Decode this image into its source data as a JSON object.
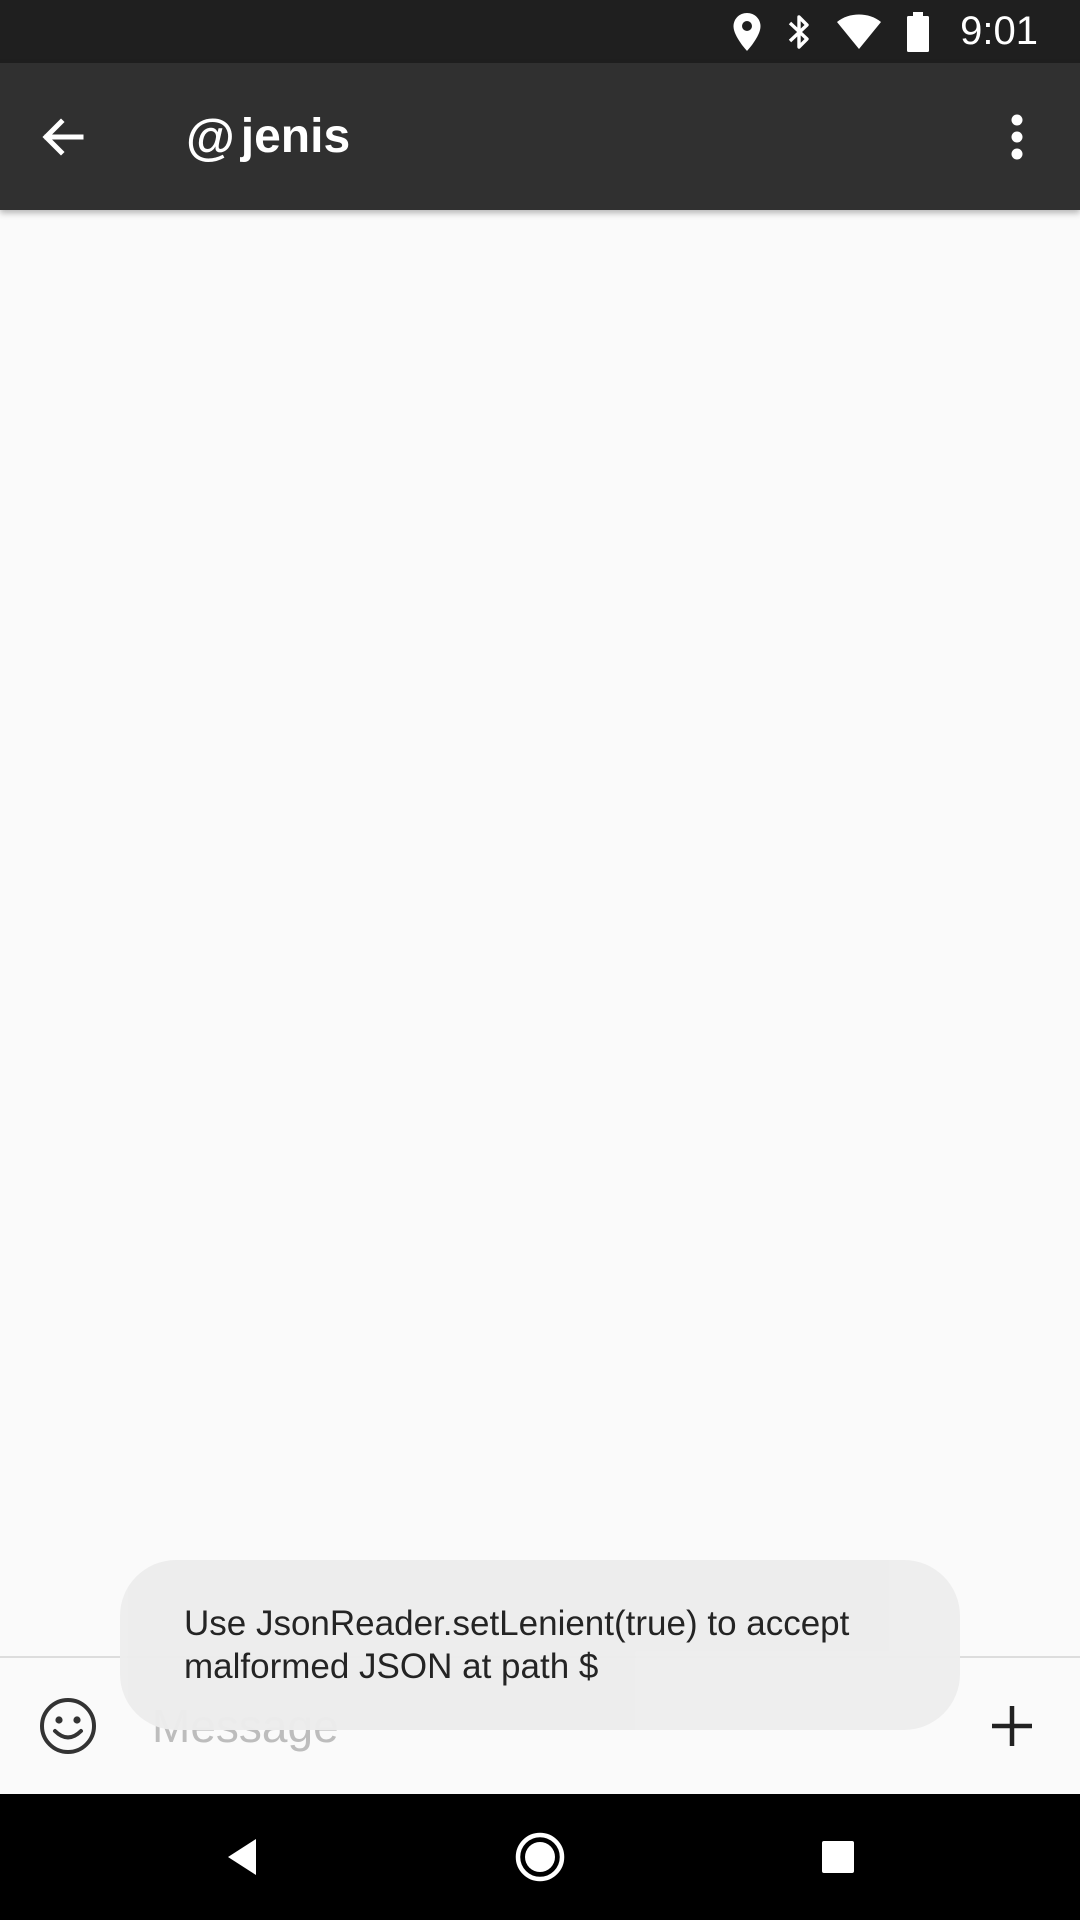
{
  "status_bar": {
    "time": "9:01",
    "icons": [
      "location-icon",
      "bluetooth-icon",
      "wifi-icon",
      "battery-icon"
    ]
  },
  "app_bar": {
    "title_prefix": "@",
    "title": "jenis",
    "back_icon": "arrow-back-icon",
    "menu_icon": "more-vertical-icon"
  },
  "composer": {
    "placeholder": "Message",
    "value": "",
    "emoji_icon": "emoji-icon",
    "add_icon": "add-icon"
  },
  "toast": {
    "line1": "Use JsonReader.setLenient(true) to accept",
    "line2": "malformed JSON at path $"
  },
  "nav_bar": {
    "icons": [
      "nav-back-icon",
      "nav-home-icon",
      "nav-recents-icon"
    ]
  },
  "colors": {
    "status_bar": "#1F1F1F",
    "app_bar": "#303030",
    "background": "#FAFAFA",
    "toast": "#EDEDED",
    "nav_bar": "#000000"
  }
}
